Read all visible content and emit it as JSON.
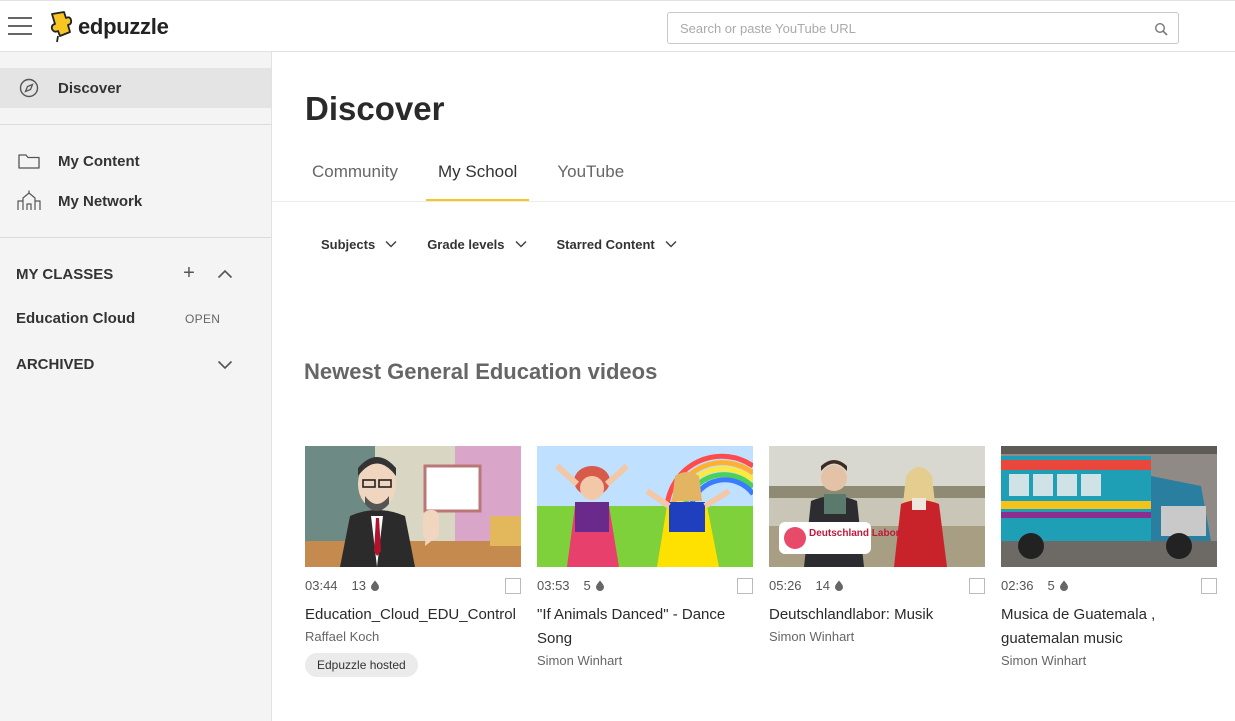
{
  "app": {
    "logo_text": "edpuzzle",
    "brand_color": "#f7c623"
  },
  "search": {
    "placeholder": "Search or paste YouTube URL",
    "value": ""
  },
  "sidebar": {
    "discover": "Discover",
    "my_content": "My Content",
    "my_network": "My Network",
    "my_classes_title": "MY CLASSES",
    "class_name": "Education Cloud",
    "class_action": "OPEN",
    "archived_title": "ARCHIVED"
  },
  "main": {
    "title": "Discover",
    "tabs": [
      {
        "label": "Community",
        "active": false
      },
      {
        "label": "My School",
        "active": true
      },
      {
        "label": "YouTube",
        "active": false
      }
    ],
    "filters": [
      {
        "label": "Subjects"
      },
      {
        "label": "Grade levels"
      },
      {
        "label": "Starred Content"
      }
    ],
    "section_heading": "Newest General Education videos",
    "videos": [
      {
        "duration": "03:44",
        "questions": "13",
        "title": "Education_Cloud_EDU_Control",
        "author": "Raffael Koch",
        "badge": "Edpuzzle hosted"
      },
      {
        "duration": "03:53",
        "questions": "5",
        "title": "\"If Animals Danced\" - Dance Song",
        "author": "Simon Winhart",
        "badge": ""
      },
      {
        "duration": "05:26",
        "questions": "14",
        "title": "Deutschlandlabor: Musik",
        "author": "Simon Winhart",
        "badge": "",
        "thumb_logo_text": "Deutschland Labor"
      },
      {
        "duration": "02:36",
        "questions": "5",
        "title": "Musica de Guatemala , guatemalan music",
        "author": "Simon Winhart",
        "badge": ""
      }
    ]
  }
}
